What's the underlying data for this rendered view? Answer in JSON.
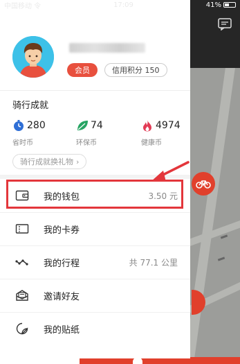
{
  "status_bar": {
    "left_text": "中国移动 令",
    "time": "17:09",
    "battery": "41%",
    "battery_level": 0.41
  },
  "profile": {
    "member_badge": "会员",
    "credit_label": "信用积分 150"
  },
  "achievements": {
    "title": "骑行成就",
    "stats": [
      {
        "value": "280",
        "label": "省时币",
        "icon": "stopwatch-icon"
      },
      {
        "value": "74",
        "label": "环保币",
        "icon": "leaf-icon"
      },
      {
        "value": "4974",
        "label": "健康币",
        "icon": "flame-icon"
      }
    ],
    "gift_button": "骑行成就换礼物",
    "gift_chevron": "›"
  },
  "menu": [
    {
      "label": "我的钱包",
      "right": "3.50 元",
      "icon": "wallet-icon"
    },
    {
      "label": "我的卡券",
      "right": "",
      "icon": "coupon-icon"
    },
    {
      "label": "我的行程",
      "right": "共 77.1 公里",
      "icon": "trip-route-icon"
    },
    {
      "label": "邀请好友",
      "right": "",
      "icon": "invite-envelope-icon"
    },
    {
      "label": "我的贴纸",
      "right": "",
      "icon": "sticker-icon"
    }
  ],
  "colors": {
    "accent_red": "#e8503e",
    "highlight_red": "#e3363b",
    "stopwatch_blue": "#2f6fd6",
    "leaf_green": "#27a463",
    "flame_red": "#e33b55"
  }
}
